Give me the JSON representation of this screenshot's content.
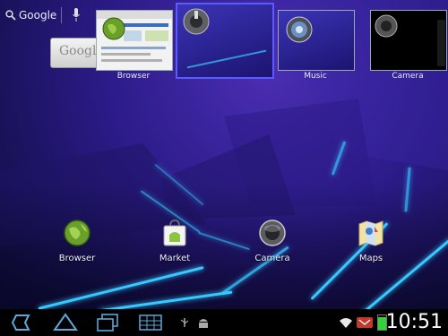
{
  "search": {
    "label": "Google"
  },
  "recents": [
    {
      "label": "Browser"
    },
    {
      "label": ""
    },
    {
      "label": "Music"
    },
    {
      "label": "Camera"
    }
  ],
  "widget": {
    "text": "Googl"
  },
  "apps": [
    {
      "label": "Browser",
      "icon": "browser-globe-icon"
    },
    {
      "label": "Market",
      "icon": "market-bag-icon"
    },
    {
      "label": "Camera",
      "icon": "camera-lens-icon"
    },
    {
      "label": "Maps",
      "icon": "maps-icon"
    }
  ],
  "statusbar": {
    "time": "10:51"
  },
  "colors": {
    "accent": "#37c8ff",
    "battery": "#35d13a"
  }
}
